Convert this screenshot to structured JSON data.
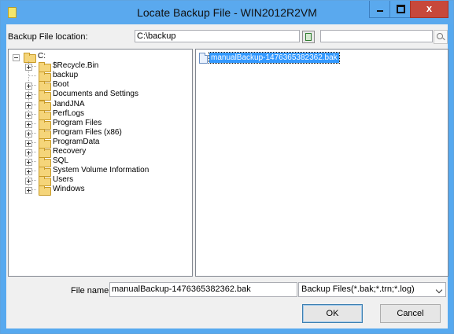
{
  "window": {
    "title": "Locate Backup File - WIN2012R2VM",
    "close_glyph": "x"
  },
  "location": {
    "label": "Backup File location:",
    "value": "C:\\backup",
    "search_value": ""
  },
  "tree": {
    "root": "C:",
    "items": [
      {
        "label": "$Recycle.Bin",
        "expandable": true
      },
      {
        "label": "backup",
        "expandable": false
      },
      {
        "label": "Boot",
        "expandable": true
      },
      {
        "label": "Documents and Settings",
        "expandable": true
      },
      {
        "label": "JandJNA",
        "expandable": true
      },
      {
        "label": "PerfLogs",
        "expandable": true
      },
      {
        "label": "Program Files",
        "expandable": true
      },
      {
        "label": "Program Files (x86)",
        "expandable": true
      },
      {
        "label": "ProgramData",
        "expandable": true
      },
      {
        "label": "Recovery",
        "expandable": true
      },
      {
        "label": "SQL",
        "expandable": true
      },
      {
        "label": "System Volume Information",
        "expandable": true
      },
      {
        "label": "Users",
        "expandable": true
      },
      {
        "label": "Windows",
        "expandable": true
      }
    ]
  },
  "files": [
    {
      "name": "manualBackup-1476365382362.bak",
      "selected": true
    }
  ],
  "footer": {
    "file_name_label": "File name:",
    "file_name_value": "manualBackup-1476365382362.bak",
    "filter_value": "Backup Files(*.bak;*.trn;*.log)",
    "ok_label": "OK",
    "cancel_label": "Cancel"
  },
  "colors": {
    "title_bar": "#5aa9ee",
    "selection": "#3399ff",
    "close_button": "#c7483b"
  }
}
